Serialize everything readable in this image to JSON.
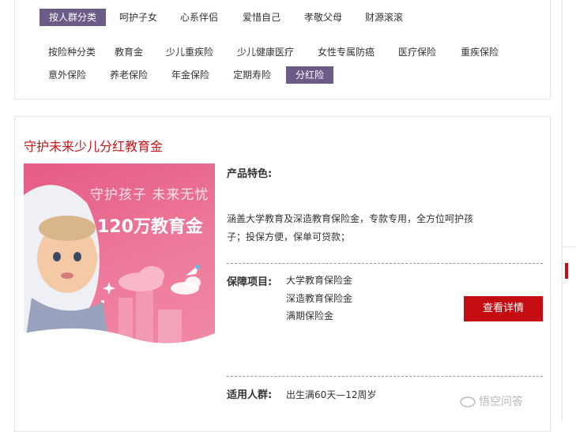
{
  "filter": {
    "row1": [
      "按人群分类",
      "呵护子女",
      "心系伴侣",
      "爱惜自己",
      "孝敬父母",
      "财源滚滚"
    ],
    "row2": [
      "按险种分类",
      "教育金",
      "少儿重疾险",
      "少儿健康医疗",
      "女性专属防癌",
      "医疗保险",
      "重疾保险"
    ],
    "row3": [
      "意外保险",
      "养老保险",
      "年金保险",
      "定期寿险",
      "分红险"
    ]
  },
  "product": {
    "title": "守护未来少儿分红教育金",
    "banner": {
      "line1": "守护孩子  未来无忧",
      "line2": "120万教育金"
    },
    "features_label": "产品特色:",
    "features_line1": "涵盖大学教育及深造教育保险金，专款专用，全方位呵护孩",
    "features_line2": "子；投保方便，保单可贷款；",
    "coverage_label": "保障项目:",
    "coverage_items": [
      "大学教育保险金",
      "深造教育保险金",
      "满期保险金"
    ],
    "detail_button": "查看详情",
    "audience_label": "适用人群:",
    "audience_value": "出生满60天—12周岁"
  },
  "watermark": "悟空问答",
  "colors": {
    "accent": "#c40d12",
    "chip_active": "#6b5b87",
    "title": "#c4161c"
  }
}
